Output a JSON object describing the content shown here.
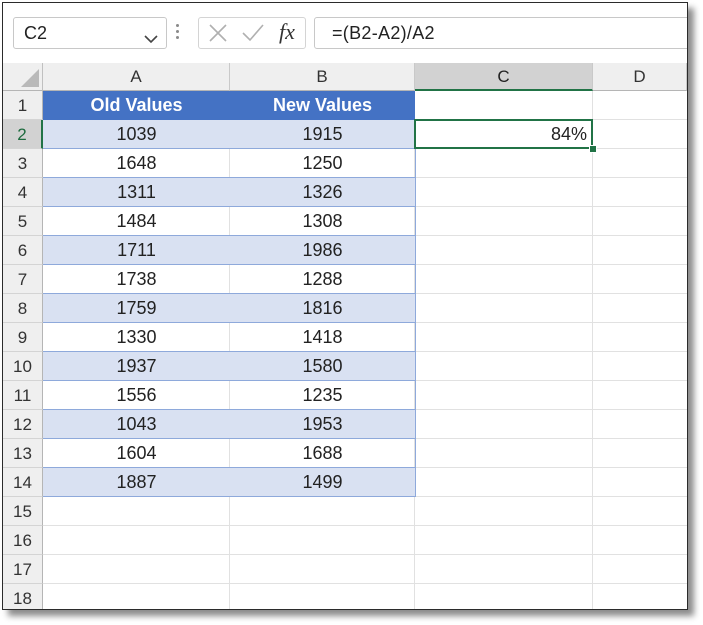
{
  "formula_bar": {
    "name_box": "C2",
    "formula": "=(B2-A2)/A2",
    "cancel_icon": "x-icon",
    "enter_icon": "check-icon",
    "fx_label": "fx"
  },
  "columns": [
    "A",
    "B",
    "C",
    "D"
  ],
  "rows": [
    "1",
    "2",
    "3",
    "4",
    "5",
    "6",
    "7",
    "8",
    "9",
    "10",
    "11",
    "12",
    "13",
    "14",
    "15",
    "16",
    "17",
    "18"
  ],
  "table": {
    "headers": [
      "Old Values",
      "New Values"
    ],
    "data": [
      [
        "1039",
        "1915"
      ],
      [
        "1648",
        "1250"
      ],
      [
        "1311",
        "1326"
      ],
      [
        "1484",
        "1308"
      ],
      [
        "1711",
        "1986"
      ],
      [
        "1738",
        "1288"
      ],
      [
        "1759",
        "1816"
      ],
      [
        "1330",
        "1418"
      ],
      [
        "1937",
        "1580"
      ],
      [
        "1556",
        "1235"
      ],
      [
        "1043",
        "1953"
      ],
      [
        "1604",
        "1688"
      ],
      [
        "1887",
        "1499"
      ]
    ]
  },
  "result_cell": {
    "ref": "C2",
    "value": "84%"
  },
  "colors": {
    "header_fill": "#4472c4",
    "band_fill": "#d9e1f2",
    "selection": "#217346"
  }
}
